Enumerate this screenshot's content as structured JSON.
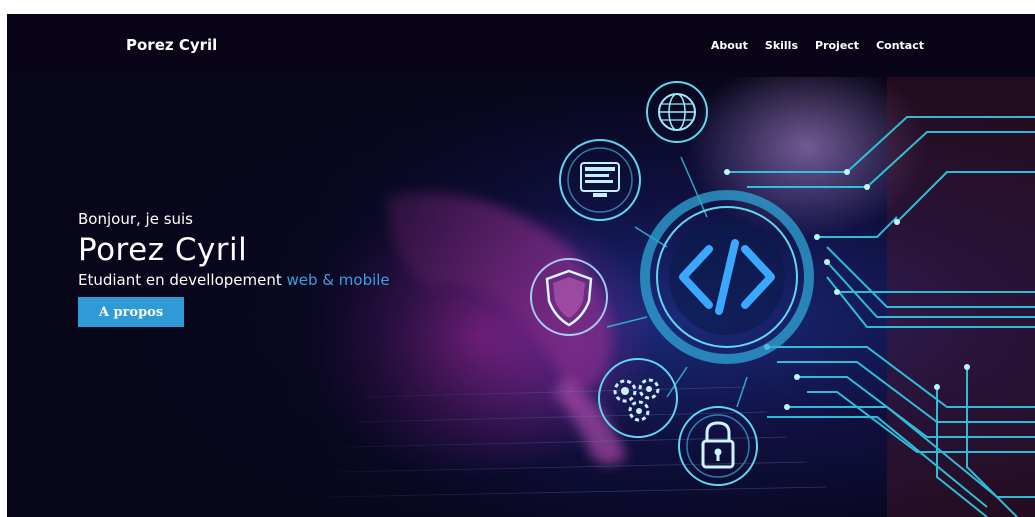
{
  "nav": {
    "brand": "Porez Cyril",
    "links": [
      "About",
      "Skills",
      "Project",
      "Contact"
    ]
  },
  "hero": {
    "greeting": "Bonjour, je suis",
    "name": "Porez Cyril",
    "subtitle_prefix": "Etudiant en devellopement ",
    "subtitle_accent": "web & mobile",
    "cta_label": "A propos"
  },
  "colors": {
    "navbar_bg": "#0a0418",
    "accent": "#3aa0e0",
    "button": "#2e9bd6",
    "circuit": "#2fd0e8"
  },
  "icons": [
    "globe-icon",
    "monitor-icon",
    "code-icon",
    "shield-icon",
    "gears-icon",
    "lock-icon"
  ]
}
